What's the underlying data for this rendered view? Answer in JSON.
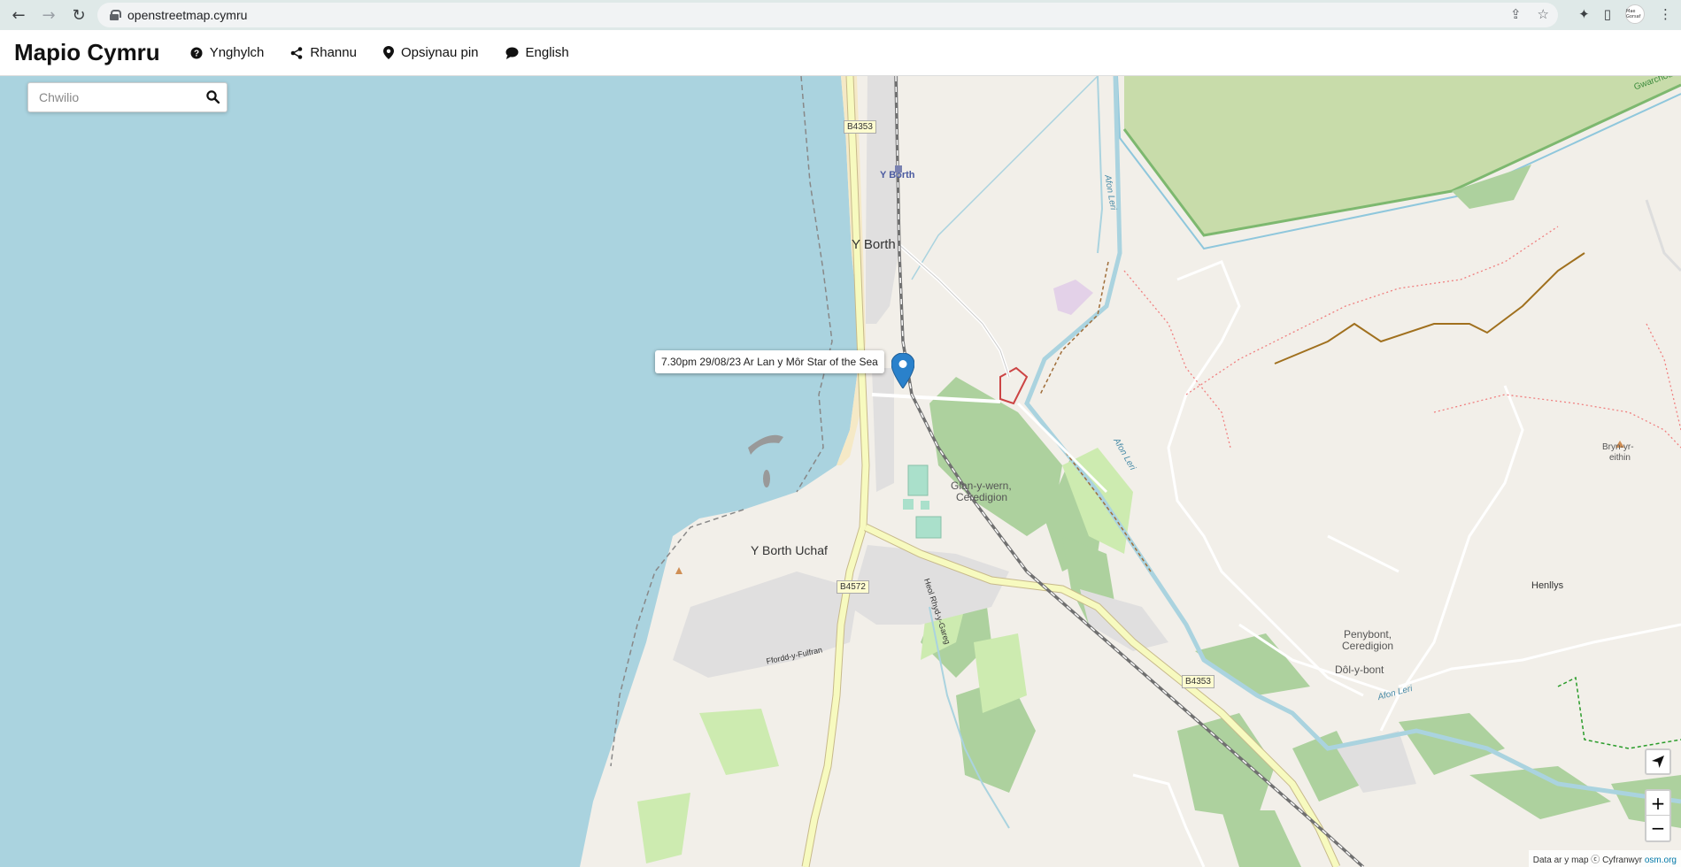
{
  "browser": {
    "url": "openstreetmap.cymru",
    "avatar_label": "Mae Gorsaf"
  },
  "header": {
    "brand": "Mapio Cymru",
    "items": [
      {
        "label": "Ynghylch",
        "icon": "question-circle-icon"
      },
      {
        "label": "Rhannu",
        "icon": "share-icon"
      },
      {
        "label": "Opsiynau pin",
        "icon": "map-pin-icon"
      },
      {
        "label": "English",
        "icon": "speech-bubble-icon"
      }
    ]
  },
  "search": {
    "placeholder": "Chwilio"
  },
  "popup": {
    "text": "7.30pm 29/08/23 Ar Lan y Môr Star of the Sea"
  },
  "map_labels": {
    "y_borth": "Y Borth",
    "y_borth_station": "Y Borth",
    "y_borth_uchaf": "Y Borth Uchaf",
    "glan_y_wern": "Glan-y-wern,",
    "ceredigion_1": "Ceredigion",
    "penybont": "Penybont,",
    "ceredigion_2": "Ceredigion",
    "dol_y_bont": "Dôl-y-bont",
    "henllys": "Henllys",
    "bryn_yr_eithin_1": "Bryn-yr-",
    "bryn_yr_eithin_2": "eithin",
    "afon_leri_1": "Afon Leri",
    "afon_leri_2": "Afon Leri",
    "afon_leri_3": "Afon Leri",
    "ffordd_y_fulfran": "Ffordd-y-Fulfran",
    "heol_rhyd_y_gareg": "Heol Rhyd-y-Gareg",
    "gwarchodfa": "Gwarchod"
  },
  "road_shields": {
    "b4353_north": "B4353",
    "b4572": "B4572",
    "b4353_south": "B4353"
  },
  "controls": {
    "zoom_in": "+",
    "zoom_out": "−"
  },
  "attribution": {
    "prefix": "Data ar y map ⓒ Cyfranwyr",
    "link": "osm.org"
  },
  "colors": {
    "sea": "#aad3df",
    "land": "#f2efe9",
    "wood": "#add19e",
    "road_yellow": "#f7fabf",
    "water": "#aad3df",
    "wetland": "#c8dcaa",
    "pin": "#2a81cb"
  }
}
